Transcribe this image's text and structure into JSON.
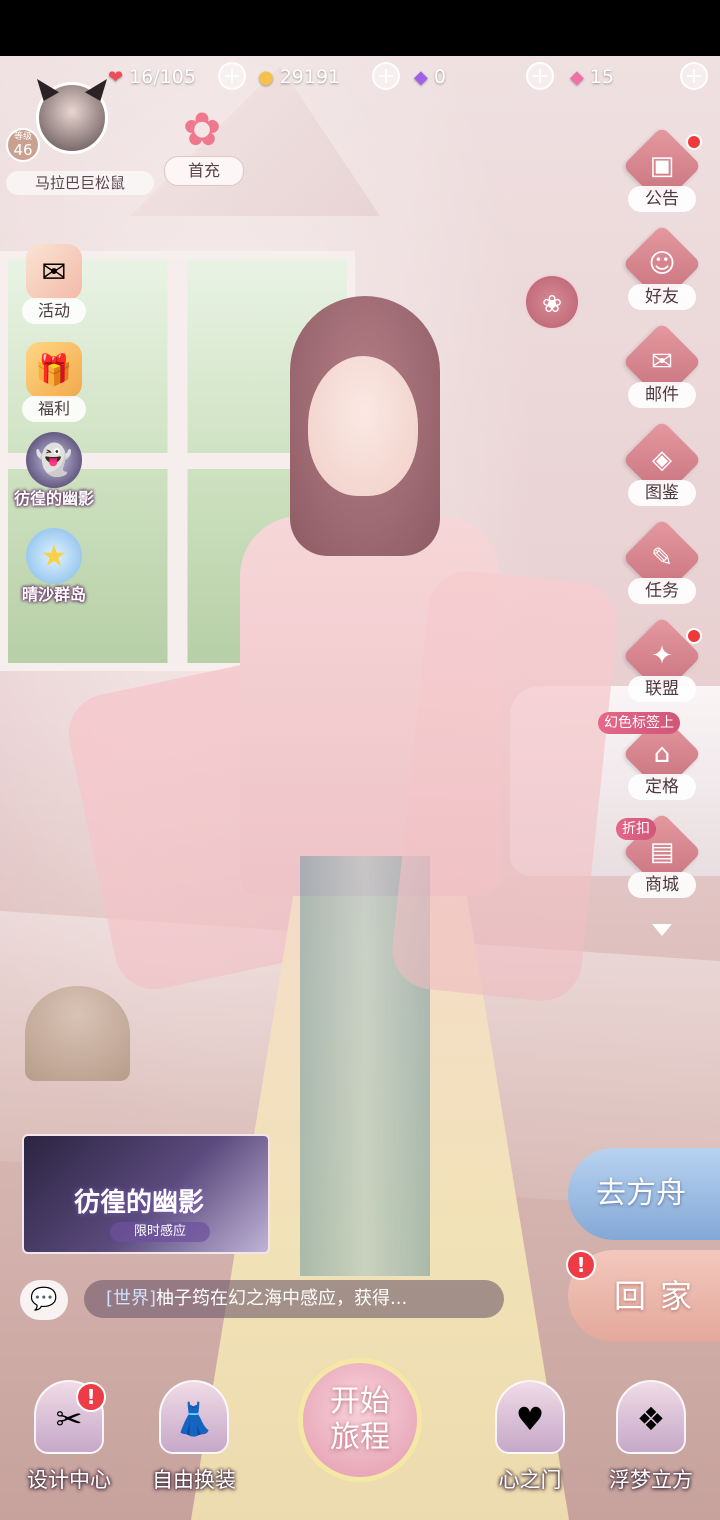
{
  "resources": [
    {
      "icon": "heart-icon",
      "glyph": "❤",
      "color": "#f04b5c",
      "value": "16/105"
    },
    {
      "icon": "coin-icon",
      "glyph": "🐱",
      "color": "#f4c24a",
      "value": "29191"
    },
    {
      "icon": "purple-gem-icon",
      "glyph": "◆",
      "color": "#a060e8",
      "value": "0"
    },
    {
      "icon": "pink-gem-icon",
      "glyph": "◆",
      "color": "#f070a8",
      "value": "15"
    }
  ],
  "player": {
    "level_caption": "等级",
    "level": "46",
    "name": "马拉巴巨松鼠"
  },
  "first_charge": {
    "label": "首充",
    "glyph": "✿"
  },
  "left_menu": [
    {
      "id": "activity",
      "label": "活动",
      "glyph": "✉"
    },
    {
      "id": "welfare",
      "label": "福利",
      "glyph": "🎁"
    },
    {
      "id": "wandering-ghost",
      "label": "彷徨的幽影",
      "glyph": "👻"
    },
    {
      "id": "sunny-sand-islands",
      "label": "晴沙群岛",
      "glyph": "★"
    }
  ],
  "right_menu": [
    {
      "id": "notice",
      "label": "公告",
      "glyph": "▣"
    },
    {
      "id": "friends",
      "label": "好友",
      "glyph": "☺"
    },
    {
      "id": "mail",
      "label": "邮件",
      "glyph": "✉"
    },
    {
      "id": "gallery",
      "label": "图鉴",
      "glyph": "◈"
    },
    {
      "id": "tasks",
      "label": "任务",
      "glyph": "✎"
    },
    {
      "id": "alliance",
      "label": "联盟",
      "glyph": "✦"
    },
    {
      "id": "photo",
      "label": "定格",
      "glyph": "⌂"
    },
    {
      "id": "shop",
      "label": "商城",
      "glyph": "▤"
    }
  ],
  "tags": {
    "photo_tag": "幻色标签上",
    "shop_tag": "折扣"
  },
  "event_banner": {
    "title": "彷徨的幽影",
    "subtitle": "限时感应"
  },
  "chat": {
    "channel": "[世界]",
    "message": "柚子筠在幻之海中感应，获得..."
  },
  "actions": {
    "ark": "去方舟",
    "home": "回家",
    "alert": "!"
  },
  "bottom_nav": [
    {
      "id": "design-center",
      "label": "设计中心",
      "glyph": "✂"
    },
    {
      "id": "free-dress",
      "label": "自由换装",
      "glyph": "👗"
    },
    {
      "id": "heart-gate",
      "label": "心之门",
      "glyph": "♥"
    },
    {
      "id": "floating-cube",
      "label": "浮梦立方",
      "glyph": "❖"
    }
  ],
  "start": {
    "line1": "开始",
    "line2": "旅程"
  }
}
